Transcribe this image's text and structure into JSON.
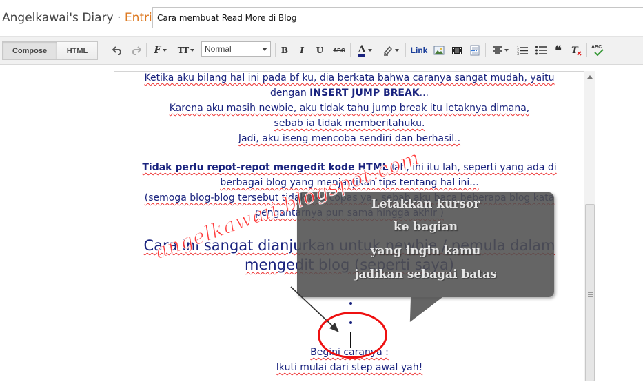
{
  "header": {
    "blog_name": "Angelkawai's Diary",
    "separator": "·",
    "section": "Entri",
    "post_title": "Cara membuat Read More di Blog"
  },
  "modes": {
    "compose": "Compose",
    "html": "HTML"
  },
  "toolbar": {
    "font_size_label": "Normal",
    "link_label": "Link",
    "bold_glyph": "B",
    "italic_glyph": "I",
    "underline_glyph": "U",
    "strike_glyph": "ABC",
    "textcolor_glyph": "A",
    "font_glyph": "F",
    "fontsize_glyph": "TT",
    "quote_glyph": "❝",
    "spell_glyph": "ABC"
  },
  "content": {
    "p1_l1": "Ketika aku bilang hal ini pada bf ku, dia berkata bahwa caranya sangat mudah, yaitu",
    "p1_l2a": "dengan ",
    "p1_l2b": "INSERT JUMP BREAK",
    "p1_l2c": "...",
    "p1_l3": "Karena aku masih newbie, aku tidak tahu jump break itu letaknya dimana,",
    "p1_l4": "sebab ia tidak memberitahuku.",
    "p1_l5": "Jadi, aku iseng mencoba sendiri dan berhasil..",
    "p2_l1a": "Tidak perlu repot-repot mengedit kode HTML",
    "p2_l1b": " lah, ini itu lah, seperti yang ada di",
    "p2_l2": "berbagai blog yang menjanjikan tips tentang hal ini...",
    "p2_l3": "(semoga blog-blog tersebut tidak aku copas ya.. sebab aku baca beberapa blog kata",
    "p2_l4": "pengantarnya pun sama hingga akhir )",
    "big_l1": "Cara ini sangat dianjurkan untuk newbie / pemula dalam",
    "big_l2": "mengedit blog (seperti saya)",
    "end_l1": "Begini caranya :",
    "end_l2": "Ikuti mulai dari step awal yah!"
  },
  "callout": {
    "l1": "Letakkan kursor",
    "l2": "ke bagian",
    "l3": "yang ingin kamu",
    "l4": "jadikan sebagai batas"
  },
  "watermark": "angelkawaii.blogspot.com",
  "colors": {
    "entri": "#dd7a23",
    "content_text": "#1a237e",
    "annotation": "#ee1111"
  }
}
